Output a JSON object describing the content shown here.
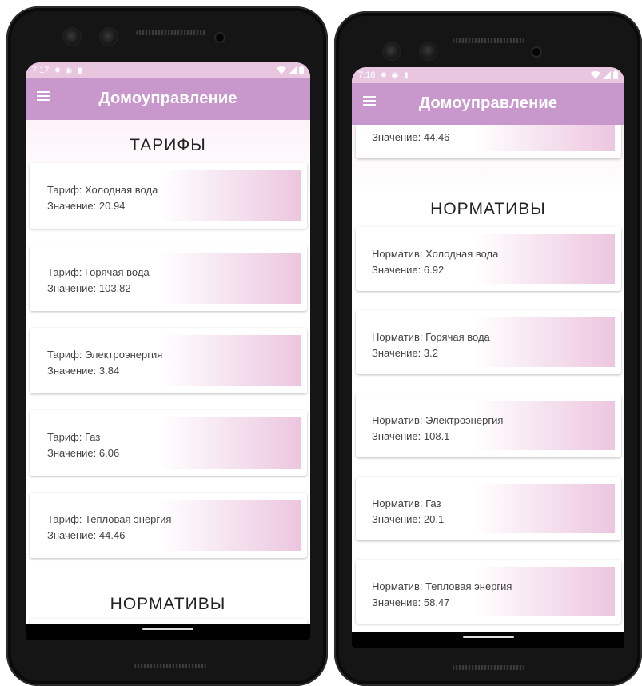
{
  "colors": {
    "status_bar": "#e9c6e0",
    "app_bar": "#c898cc",
    "card_gradient_end": "#ecc6df",
    "phone_frame": "#151515"
  },
  "left_phone": {
    "status": {
      "time": "7:17",
      "icons": [
        "gear-icon",
        "shield-icon",
        "sd-card-icon"
      ],
      "right_icons": [
        "wifi-icon",
        "signal-icon",
        "battery-icon"
      ]
    },
    "app_bar": {
      "title": "Домоуправление",
      "menu_icon": "menu-icon"
    },
    "sections": {
      "tariffs_heading": "ТАРИФЫ",
      "norms_heading": "НОРМАТИВЫ"
    },
    "tariffs": [
      {
        "name": "Тариф: Холодная вода",
        "value": "Значение: 20.94"
      },
      {
        "name": "Тариф: Горячая вода",
        "value": "Значение: 103.82"
      },
      {
        "name": "Тариф: Электроэнергия",
        "value": "Значение: 3.84"
      },
      {
        "name": "Тариф: Газ",
        "value": "Значение: 6.06"
      },
      {
        "name": "Тариф: Тепловая энергия",
        "value": "Значение: 44.46"
      }
    ]
  },
  "right_phone": {
    "status": {
      "time": "7:18",
      "icons": [
        "gear-icon",
        "shield-icon",
        "sd-card-icon"
      ],
      "right_icons": [
        "wifi-icon",
        "signal-icon",
        "battery-icon"
      ]
    },
    "app_bar": {
      "title": "Домоуправление",
      "menu_icon": "menu-icon"
    },
    "partial_card_value": "Значение: 44.46",
    "sections": {
      "norms_heading": "НОРМАТИВЫ"
    },
    "norms": [
      {
        "name": "Норматив: Холодная вода",
        "value": "Значение: 6.92"
      },
      {
        "name": "Норматив: Горячая вода",
        "value": "Значение: 3.2"
      },
      {
        "name": "Норматив: Электроэнергия",
        "value": "Значение: 108.1"
      },
      {
        "name": "Норматив: Газ",
        "value": "Значение: 20.1"
      },
      {
        "name": "Норматив: Тепловая энергия",
        "value": "Значение: 58.47"
      }
    ]
  }
}
